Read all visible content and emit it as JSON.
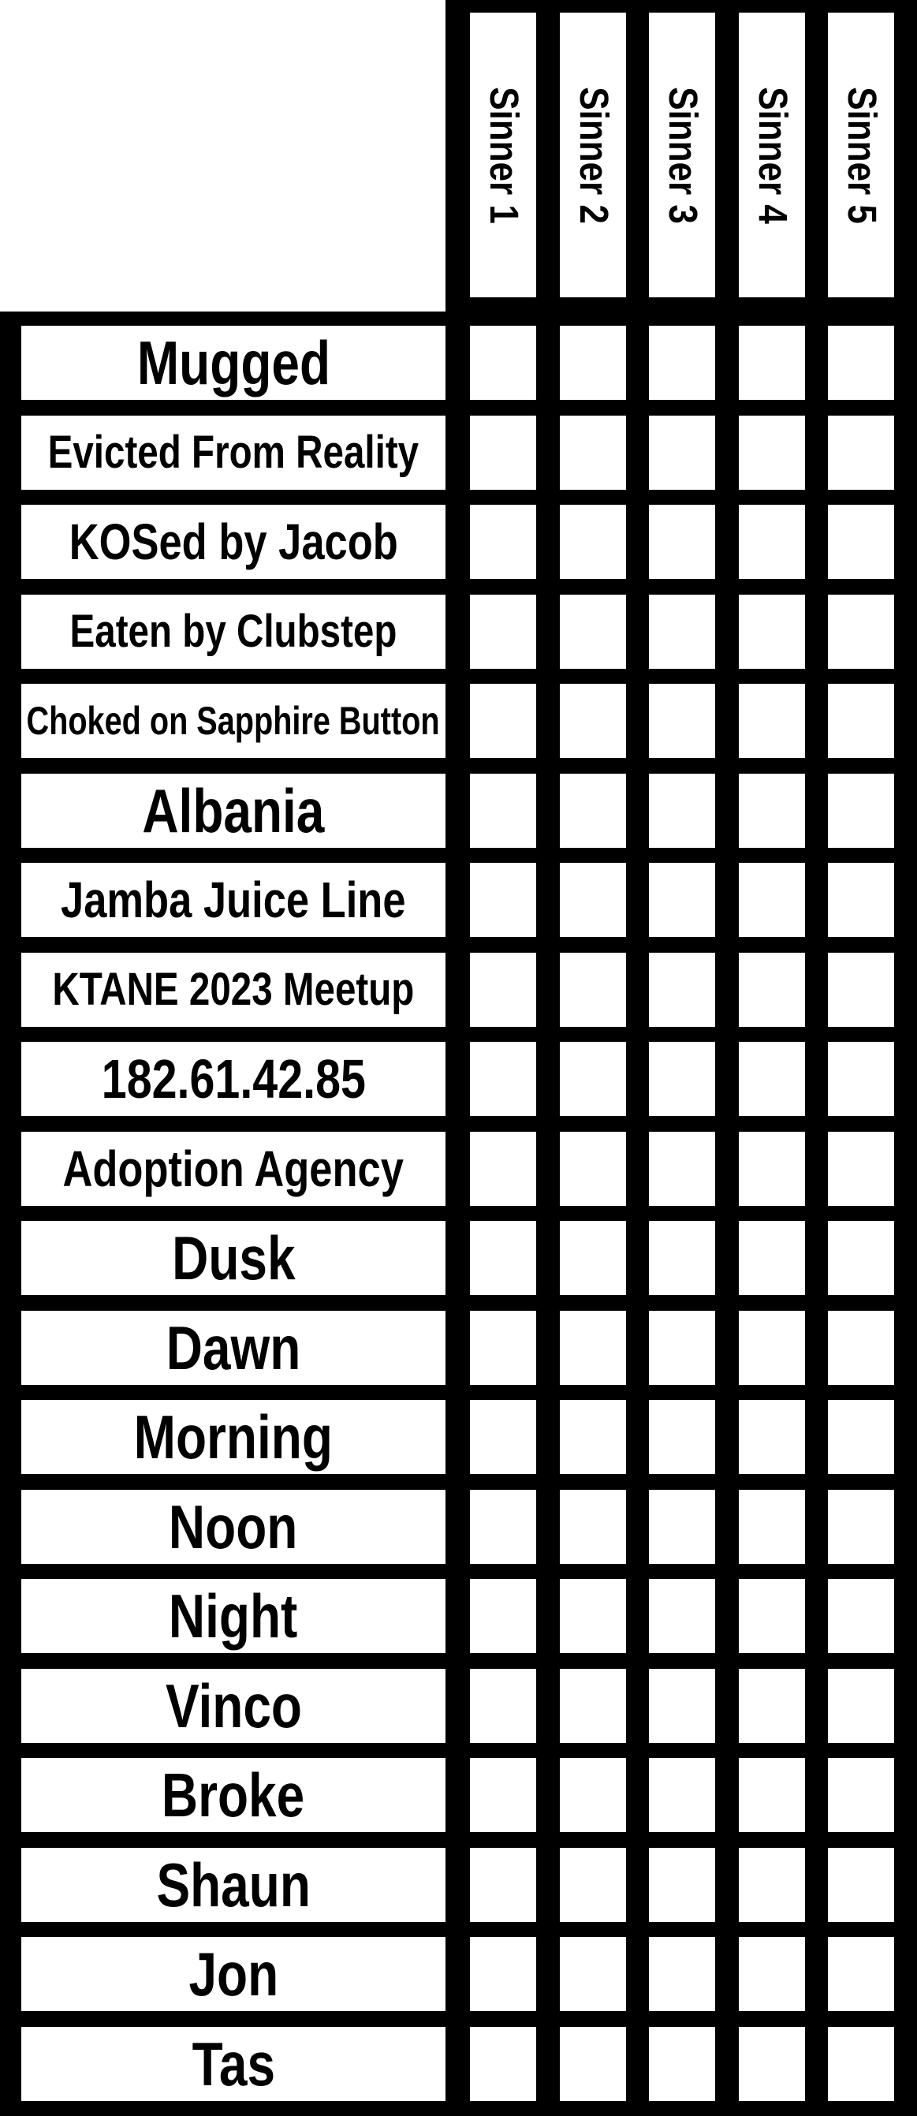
{
  "colors": {
    "background": "#ffffff",
    "grid_line": "#000000",
    "text": "#000000"
  },
  "columns": [
    {
      "label": "Sinner 1"
    },
    {
      "label": "Sinner 2"
    },
    {
      "label": "Sinner 3"
    },
    {
      "label": "Sinner 4"
    },
    {
      "label": "Sinner 5"
    }
  ],
  "rows": [
    {
      "label": "Mugged"
    },
    {
      "label": "Evicted From Reality"
    },
    {
      "label": "KOSed by Jacob"
    },
    {
      "label": "Eaten by Clubstep"
    },
    {
      "label": "Choked on Sapphire Button"
    },
    {
      "label": "Albania"
    },
    {
      "label": "Jamba Juice Line"
    },
    {
      "label": "KTANE 2023 Meetup"
    },
    {
      "label": "182.61.42.85"
    },
    {
      "label": "Adoption Agency"
    },
    {
      "label": "Dusk"
    },
    {
      "label": "Dawn"
    },
    {
      "label": "Morning"
    },
    {
      "label": "Noon"
    },
    {
      "label": "Night"
    },
    {
      "label": "Vinco"
    },
    {
      "label": "Broke"
    },
    {
      "label": "Shaun"
    },
    {
      "label": "Jon"
    },
    {
      "label": "Tas"
    }
  ]
}
